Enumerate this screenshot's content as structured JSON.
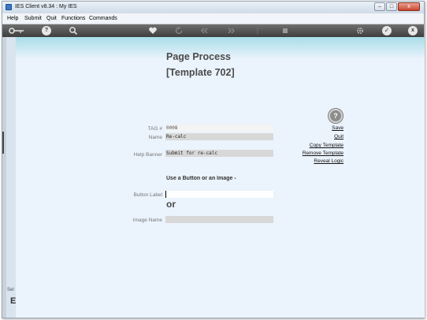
{
  "window": {
    "title": "IES Client v8.34 : My IES",
    "buttons": {
      "minimize": "–",
      "maximize": "□",
      "close": "x"
    }
  },
  "menu": {
    "items": [
      "Help",
      "Submit",
      "Quit",
      "Functions",
      "Commands"
    ]
  },
  "toolbar": {
    "icons": [
      "key-icon",
      "help-icon",
      "search-icon",
      "heart-icon",
      "refresh-icon",
      "back-double-icon",
      "forward-double-icon",
      "bookmark-icon",
      "stop-icon",
      "settings-icon",
      "check-icon",
      "close-icon"
    ],
    "help_glyph": "?",
    "check_glyph": "✓",
    "close_glyph": "x"
  },
  "sidebar": {
    "label": "Sel",
    "big_letter": "E"
  },
  "page": {
    "title": "Page Process",
    "subtitle": "[Template 702]"
  },
  "form": {
    "tag_label": "TAG #",
    "tag_value": "0008",
    "name_label": "Name",
    "name_value": "Re-calc",
    "help_banner_label": "Help Banner",
    "help_banner_value": "Submit for re-calc",
    "section_text": "Use a Button or an Image -",
    "button_label_label": "Button Label",
    "button_label_value": "",
    "or_text": "or",
    "image_name_label": "Image Name",
    "image_name_value": ""
  },
  "actions": {
    "help_glyph": "?",
    "save": "Save",
    "quit": "Quit",
    "copy_template": "Copy Template",
    "remove_template": "Remove Template",
    "reveal_logic": "Reveal Logic"
  }
}
